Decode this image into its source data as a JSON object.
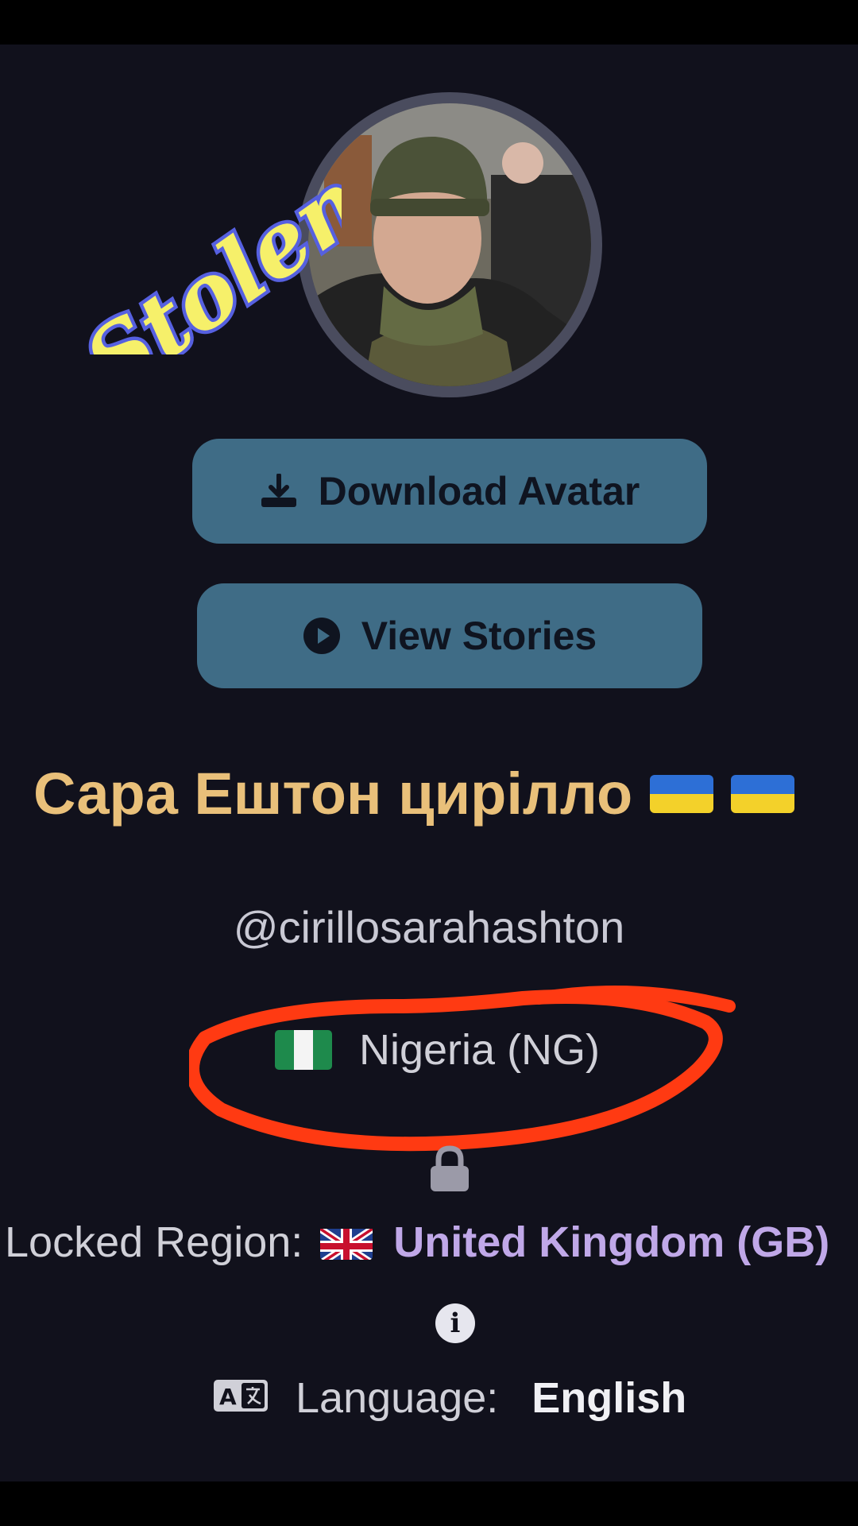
{
  "overlay": {
    "stamp_text": "Stolen"
  },
  "buttons": {
    "download_avatar": "Download Avatar",
    "view_stories": "View Stories"
  },
  "profile": {
    "display_name": "Сара Ештон цирілло",
    "handle": "@cirillosarahashton",
    "country": "Nigeria (NG)",
    "locked_region_label": "Locked Region:",
    "locked_region_value": "United Kingdom (GB)",
    "language_label": "Language:",
    "language_value": "English"
  },
  "icons": {
    "download": "download-icon",
    "play": "play-icon",
    "lock": "lock-icon",
    "info": "info-icon",
    "translate": "translate-icon"
  },
  "colors": {
    "background": "#11111c",
    "button": "#3f6c86",
    "name": "#e9c07a",
    "region_value": "#c0a8e8",
    "annotation_circle": "#ff3a12"
  }
}
